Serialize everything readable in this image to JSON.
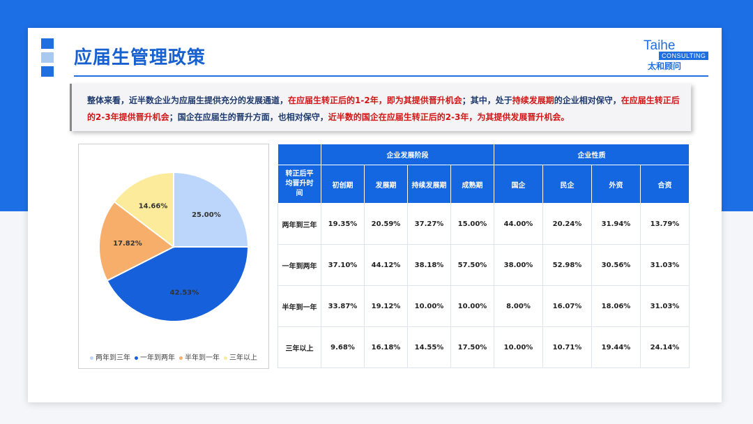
{
  "header": {
    "title": "应届生管理政策"
  },
  "logo": {
    "en": "Taihe",
    "tag": "CONSULTING",
    "cn": "太和顾问"
  },
  "summary": {
    "s1": "整体来看，近半数企业为应届生提供充分的发展通道，",
    "s2": "在应届生转正后的1-2年，即为其提供晋升机会",
    "s3": "；其中，处于",
    "s4": "持续发展期",
    "s5": "的企业相对保守，",
    "s6": "在应届生转正后的2-3年提供晋升机会",
    "s7": "；国企在应届生的晋升方面，也相对保守，",
    "s8": "近半数的国企在应届生转正后的2-3年，为其提供发展晋升机会。"
  },
  "colors": {
    "accent": "#1f6fe0",
    "highlight": "#d11717"
  },
  "chart_data": [
    {
      "type": "pie",
      "categories": [
        "两年到三年",
        "一年到两年",
        "半年到一年",
        "三年以上"
      ],
      "values": [
        25.0,
        42.53,
        17.82,
        14.66
      ],
      "labels": [
        "25.00%",
        "42.53%",
        "17.82%",
        "14.66%"
      ],
      "colors": [
        "#bcd6fb",
        "#1661db",
        "#f6ae6a",
        "#fbeb9b"
      ],
      "legend_position": "bottom"
    },
    {
      "type": "table",
      "groups": [
        {
          "label": "企业发展阶段",
          "span": 4
        },
        {
          "label": "企业性质",
          "span": 4
        }
      ],
      "row_header_label": "转正后平均晋升时间",
      "columns": [
        "初创期",
        "发展期",
        "持续发展期",
        "成熟期",
        "国企",
        "民企",
        "外资",
        "合资"
      ],
      "rows": [
        {
          "label": "两年到三年",
          "cells": [
            "19.35%",
            "20.59%",
            "37.27%",
            "15.00%",
            "44.00%",
            "20.24%",
            "31.94%",
            "13.79%"
          ]
        },
        {
          "label": "一年到两年",
          "cells": [
            "37.10%",
            "44.12%",
            "38.18%",
            "57.50%",
            "38.00%",
            "52.98%",
            "30.56%",
            "31.03%"
          ]
        },
        {
          "label": "半年到一年",
          "cells": [
            "33.87%",
            "19.12%",
            "10.00%",
            "10.00%",
            "8.00%",
            "16.07%",
            "18.06%",
            "31.03%"
          ]
        },
        {
          "label": "三年以上",
          "cells": [
            "9.68%",
            "16.18%",
            "14.55%",
            "17.50%",
            "10.00%",
            "10.71%",
            "19.44%",
            "24.14%"
          ]
        }
      ]
    }
  ]
}
